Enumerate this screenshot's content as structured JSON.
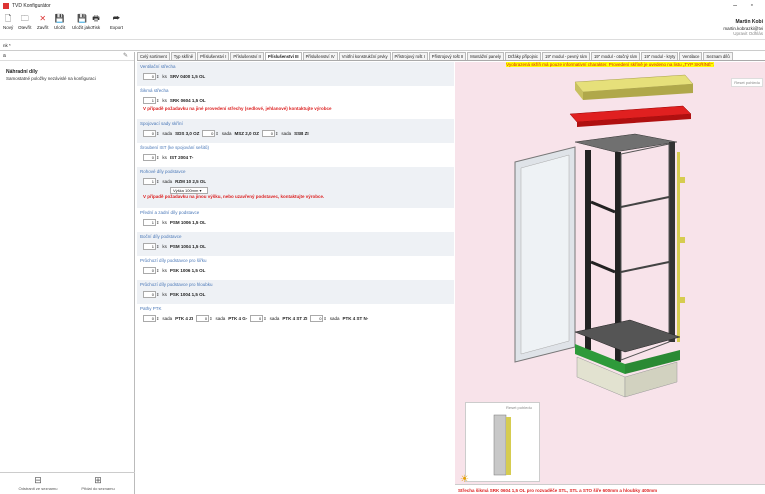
{
  "window": {
    "title": "TVD Konfigurátor",
    "minimize": "–",
    "maximize": "▫"
  },
  "toolbar": {
    "buttons": [
      {
        "label": "Nový",
        "icon": "🗋"
      },
      {
        "label": "Otevřít",
        "icon": "🗀"
      },
      {
        "label": "Zavřít",
        "icon": "✕"
      },
      {
        "label": "Uložit",
        "icon": "💾"
      },
      {
        "label": "Uložit jako",
        "icon": "💾"
      },
      {
        "label": "Tisk",
        "icon": "🖶"
      },
      {
        "label": "Export",
        "icon": "⮫"
      }
    ]
  },
  "user": {
    "name": "Martin Kobi",
    "email": "martin.kobrazki@tvi",
    "link": "Upravit Odhlás"
  },
  "address": "nk *",
  "left": {
    "search_value": "a",
    "heading": "Náhradní díly",
    "description": "Samostatné položky nezávislé na konfiguraci",
    "footer_btn1": "Odstranit ze seznamu",
    "footer_btn2": "Přidat do seznamu"
  },
  "tabs": [
    "Celý sortiment",
    "Typ skříně",
    "Příslušenství I",
    "Příslušenství II",
    "Příslušenství III",
    "Příslušenství IV",
    "Vnitřní konstrukční prvky",
    "Přístrojový rošt I",
    "Přístrojový rošt II",
    "Montážní panely",
    "Držáky přípojnic",
    "19\" modul - pevný rám",
    "19\" modul - otočný rám",
    "19\" modul - kryty",
    "Ventilace",
    "Seznam dílů"
  ],
  "active_tab": 4,
  "sections": [
    {
      "label": "Ventilační střecha",
      "items": [
        {
          "qty": "0",
          "unit": "ks",
          "code": "SRV 0400 1,5 OL"
        }
      ]
    },
    {
      "label": "Šikmá střecha",
      "items": [
        {
          "qty": "1",
          "unit": "ks",
          "code": "SRK 0604 1,5 OL"
        }
      ],
      "warn": "V případě požadavku na jiné provedení střechy (sedlové, jehlanové) kontaktujte výrobce"
    },
    {
      "label": "Spojovací sady skříní",
      "items": [
        {
          "qty": "0",
          "unit": "sada",
          "code": "SDS 3,0 OZ"
        },
        {
          "qty": "0",
          "unit": "sada",
          "code": "MSZ 2,0 OZ"
        },
        {
          "qty": "0",
          "unit": "sada",
          "code": "SSB ZI"
        }
      ]
    },
    {
      "label": "Šroubení IST (ke spojování sešitů)",
      "items": [
        {
          "qty": "0",
          "unit": "ks",
          "code": "IST 2004 T-"
        }
      ]
    },
    {
      "label": "Rohové díly podstavce",
      "items": [
        {
          "qty": "1",
          "unit": "sada",
          "code": "RZM 10 2,5 OL"
        }
      ],
      "select": "Výška 100mm",
      "warn": "V případě požadavku na jinou výšku, nebo uzavřený podstavec, kontaktujte výrobce."
    },
    {
      "label": "Přední a zadní díly podstavce",
      "items": [
        {
          "qty": "1",
          "unit": "ks",
          "code": "PSM 1006 1,5 OL"
        }
      ]
    },
    {
      "label": "Boční díly podstavce",
      "items": [
        {
          "qty": "1",
          "unit": "ks",
          "code": "PSM 1004 1,5 OL"
        }
      ]
    },
    {
      "label": "Průchozí díly podstavce pro šířku",
      "items": [
        {
          "qty": "0",
          "unit": "ks",
          "code": "PSK 1006 1,5 OL"
        }
      ]
    },
    {
      "label": "Průchozí díly podstavce pro hloubku",
      "items": [
        {
          "qty": "0",
          "unit": "ks",
          "code": "PSK 1004 1,5 OL"
        }
      ]
    },
    {
      "label": "Pathy PTK",
      "items": [
        {
          "qty": "0",
          "unit": "sada",
          "code": "PTK 4 ZI"
        },
        {
          "qty": "0",
          "unit": "sada",
          "code": "PTK 4 G-"
        },
        {
          "qty": "0",
          "unit": "sada",
          "code": "PTK 4 ST ZI"
        },
        {
          "qty": "0",
          "unit": "sada",
          "code": "PTK 4 ST N-"
        }
      ]
    }
  ],
  "viewer": {
    "notice": "Vyobrazená skříň má pouze informativní charakter. Provedení skříně je uvedeno na listu „TYP SKŘÍNĚ\".",
    "reset": "Reset pohledu",
    "thumb_reset": "Reset pohledu",
    "bottom_text": "Střecha šikmá SRK 0604 1,5 OL pro rozvaděče STL, STL a STO šíře 600mm a hloubky 400mm"
  },
  "colors": {
    "accent": "#4a78b8",
    "warn": "#d22222",
    "viewer_bg": "#f8e3ea"
  }
}
